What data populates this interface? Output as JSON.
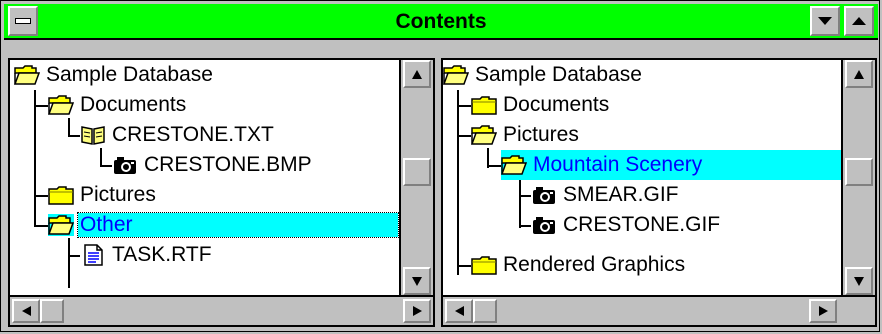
{
  "window": {
    "title": "Contents",
    "system_menu_icon": "system-menu-icon",
    "minimize_icon": "minimize-icon",
    "maximize_icon": "maximize-icon"
  },
  "colors": {
    "titlebar": "#00ff00",
    "selection_bg": "#00ffff",
    "selection_text": "#0000ff",
    "face": "#c0c0c0"
  },
  "left_tree": {
    "root": "Sample Database",
    "items": [
      {
        "label": "Documents",
        "icon": "open-folder-icon"
      },
      {
        "label": "CRESTONE.TXT",
        "icon": "open-book-icon"
      },
      {
        "label": "CRESTONE.BMP",
        "icon": "camera-icon"
      },
      {
        "label": "Pictures",
        "icon": "folder-icon"
      },
      {
        "label": "Other",
        "icon": "open-folder-icon",
        "selected": true
      },
      {
        "label": "TASK.RTF",
        "icon": "document-icon"
      }
    ]
  },
  "right_tree": {
    "root": "Sample Database",
    "items": [
      {
        "label": "Documents",
        "icon": "folder-icon"
      },
      {
        "label": "Pictures",
        "icon": "open-folder-icon"
      },
      {
        "label": "Mountain Scenery",
        "icon": "open-folder-icon",
        "selected": true
      },
      {
        "label": "SMEAR.GIF",
        "icon": "camera-icon"
      },
      {
        "label": "CRESTONE.GIF",
        "icon": "camera-icon"
      },
      {
        "label": "Rendered Graphics",
        "icon": "folder-icon"
      }
    ]
  }
}
